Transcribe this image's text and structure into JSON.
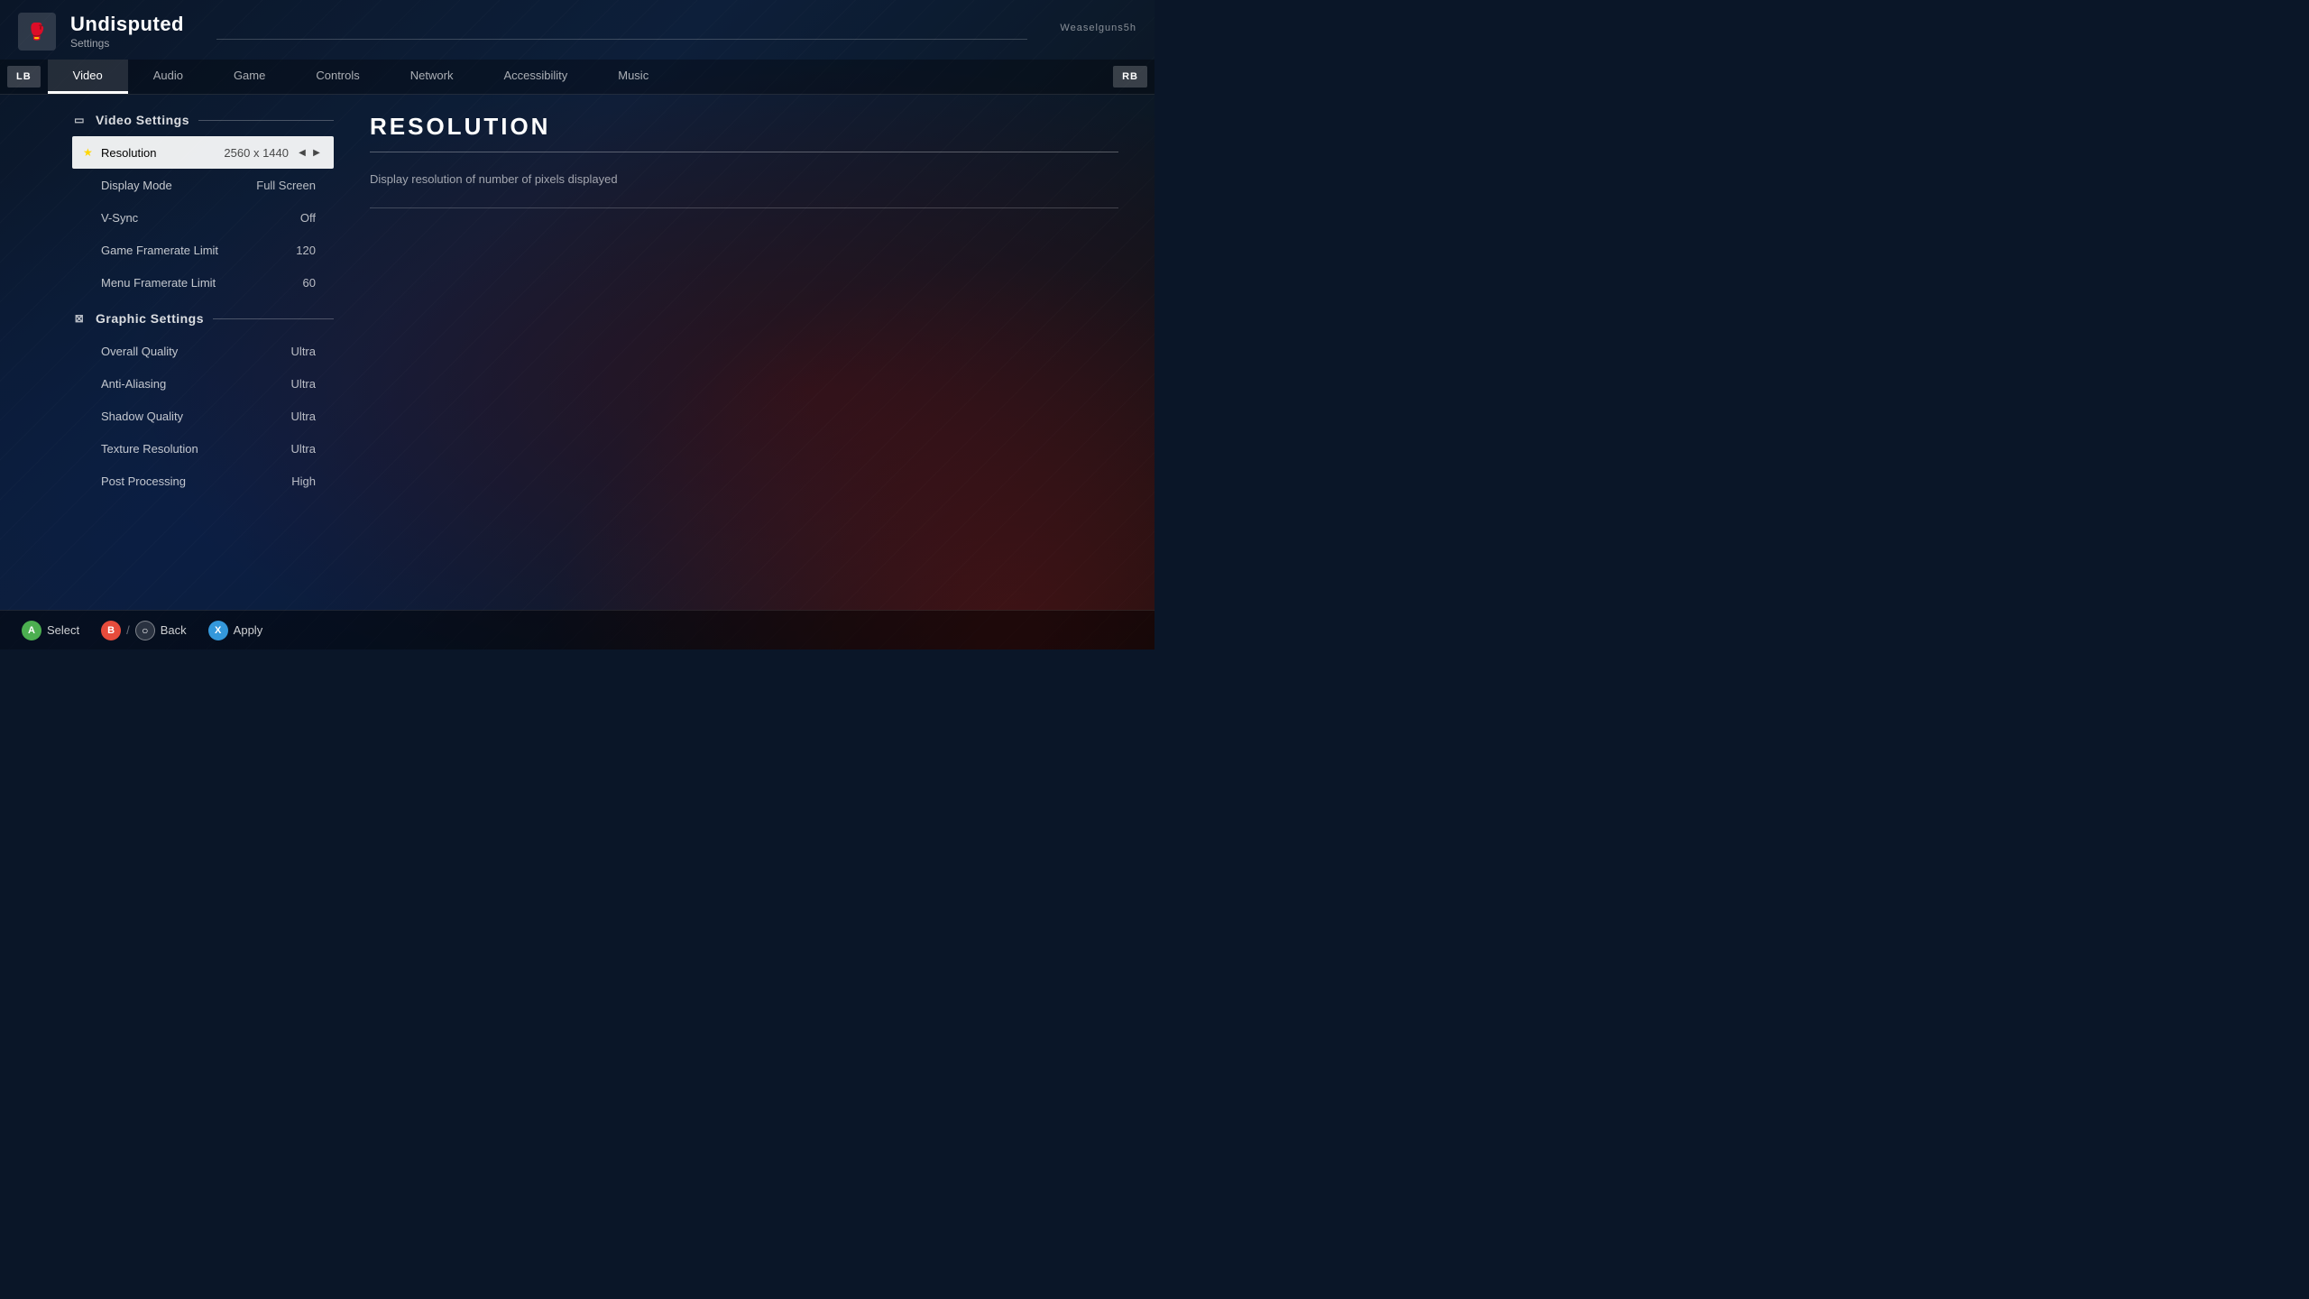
{
  "app": {
    "icon": "🥊",
    "title": "Undisputed",
    "subtitle": "Settings",
    "username": "Weaselguns5h"
  },
  "tabs": {
    "lb_label": "LB",
    "rb_label": "RB",
    "items": [
      {
        "id": "video",
        "label": "Video",
        "active": true
      },
      {
        "id": "audio",
        "label": "Audio",
        "active": false
      },
      {
        "id": "game",
        "label": "Game",
        "active": false
      },
      {
        "id": "controls",
        "label": "Controls",
        "active": false
      },
      {
        "id": "network",
        "label": "Network",
        "active": false
      },
      {
        "id": "accessibility",
        "label": "Accessibility",
        "active": false
      },
      {
        "id": "music",
        "label": "Music",
        "active": false
      }
    ]
  },
  "video_settings": {
    "section_label": "Video Settings",
    "section_icon": "monitor",
    "items": [
      {
        "id": "resolution",
        "label": "Resolution",
        "value": "2560 x 1440",
        "selected": true,
        "starred": true,
        "has_arrows": true
      },
      {
        "id": "display_mode",
        "label": "Display Mode",
        "value": "Full Screen",
        "selected": false,
        "starred": false
      },
      {
        "id": "vsync",
        "label": "V-Sync",
        "value": "Off",
        "selected": false,
        "starred": false
      },
      {
        "id": "game_framerate_limit",
        "label": "Game Framerate Limit",
        "value": "120",
        "selected": false,
        "starred": false
      },
      {
        "id": "menu_framerate_limit",
        "label": "Menu Framerate Limit",
        "value": "60",
        "selected": false,
        "starred": false
      }
    ]
  },
  "graphic_settings": {
    "section_label": "Graphic Settings",
    "section_icon": "graphic",
    "items": [
      {
        "id": "overall_quality",
        "label": "Overall Quality",
        "value": "Ultra",
        "selected": false,
        "starred": false
      },
      {
        "id": "anti_aliasing",
        "label": "Anti-Aliasing",
        "value": "Ultra",
        "selected": false,
        "starred": false
      },
      {
        "id": "shadow_quality",
        "label": "Shadow Quality",
        "value": "Ultra",
        "selected": false,
        "starred": false
      },
      {
        "id": "texture_resolution",
        "label": "Texture Resolution",
        "value": "Ultra",
        "selected": false,
        "starred": false
      },
      {
        "id": "post_processing",
        "label": "Post Processing",
        "value": "High",
        "selected": false,
        "starred": false
      }
    ]
  },
  "detail": {
    "title": "RESOLUTION",
    "description": "Display resolution of number of pixels displayed"
  },
  "bottom_bar": {
    "select_icon": "A",
    "select_label": "Select",
    "back_icon_b": "B",
    "back_icon_circle": "○",
    "back_label": "Back",
    "apply_icon": "X",
    "apply_label": "Apply"
  }
}
